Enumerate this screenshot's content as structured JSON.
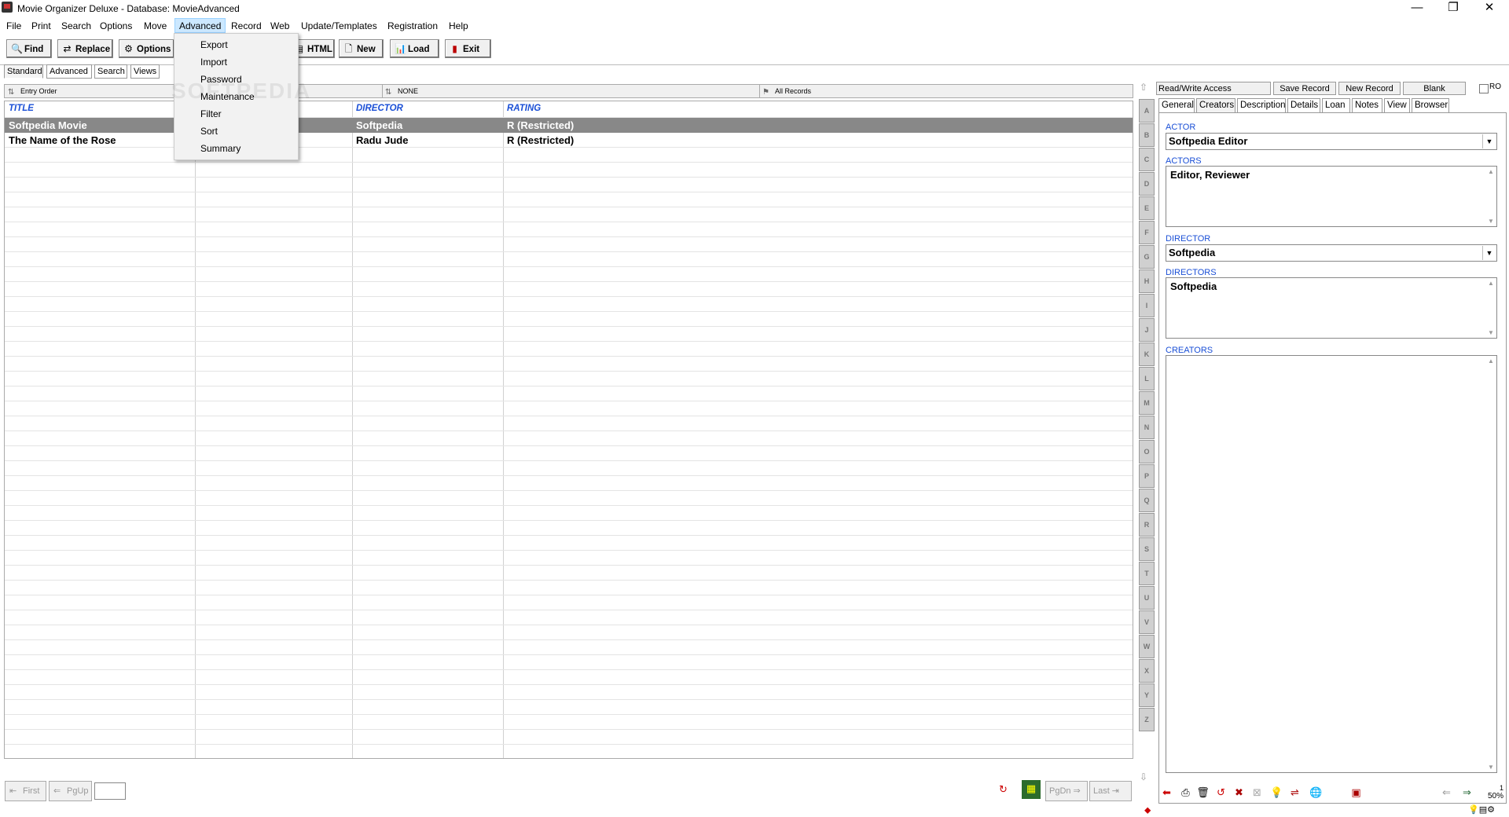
{
  "window": {
    "title": "Movie Organizer Deluxe - Database: MovieAdvanced",
    "controls": {
      "minimize": "—",
      "maximize": "❐",
      "close": "✕"
    }
  },
  "menubar": [
    "File",
    "Print",
    "Search",
    "Options",
    "Move",
    "Advanced",
    "Record",
    "Web",
    "Update/Templates",
    "Registration",
    "Help"
  ],
  "toolbar": {
    "find": "Find",
    "replace": "Replace",
    "options": "Options",
    "html": "HTML",
    "new": "New",
    "load": "Load",
    "exit": "Exit"
  },
  "view_tabs": [
    "Standard",
    "Advanced",
    "Search",
    "Views"
  ],
  "advanced_menu": [
    "Export",
    "Import",
    "Password",
    "Maintenance",
    "Filter",
    "Sort",
    "Summary"
  ],
  "watermark": "SOFTPEDIA",
  "grid_info": {
    "order": "Entry Order",
    "filter": "NONE",
    "records": "All Records"
  },
  "grid": {
    "columns": [
      "TITLE",
      "",
      "DIRECTOR",
      "RATING"
    ],
    "rows": [
      {
        "title": "Softpedia Movie",
        "director": "Softpedia",
        "rating": "R (Restricted)",
        "selected": true
      },
      {
        "title": "The Name of the Rose",
        "director": "Radu Jude",
        "rating": "R (Restricted)",
        "selected": false
      }
    ]
  },
  "alphabet": [
    "A",
    "B",
    "C",
    "D",
    "E",
    "F",
    "G",
    "H",
    "I",
    "J",
    "K",
    "L",
    "M",
    "N",
    "O",
    "P",
    "Q",
    "R",
    "S",
    "T",
    "U",
    "V",
    "W",
    "X",
    "Y",
    "Z"
  ],
  "right_panel": {
    "access": "Read/Write Access",
    "save_record": "Save Record",
    "new_record": "New Record",
    "blank": "Blank",
    "ro": "RO",
    "tabs": [
      "General",
      "Creators",
      "Description",
      "Details",
      "Loan",
      "Notes",
      "View",
      "Browser"
    ],
    "selected_tab": "Creators",
    "actor_label": "ACTOR",
    "actor_value": "Softpedia Editor",
    "actors_label": "ACTORS",
    "actors_value": "Editor, Reviewer",
    "director_label": "DIRECTOR",
    "director_value": "Softpedia",
    "directors_label": "DIRECTORS",
    "directors_value": "Softpedia",
    "creators_label": "CREATORS",
    "creators_value": ""
  },
  "bottom_nav": {
    "first": "First",
    "pgup": "PgUp",
    "pgdn": "PgDn",
    "last": "Last",
    "page_input": ""
  },
  "zoom": {
    "page": "1",
    "percent": "50%"
  }
}
